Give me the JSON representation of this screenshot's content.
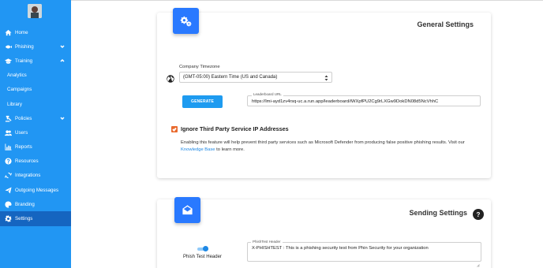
{
  "sidebar": {
    "items": [
      {
        "label": "Home",
        "icon": "home-icon"
      },
      {
        "label": "Phishing",
        "icon": "fish-icon",
        "chevron": "down"
      },
      {
        "label": "Training",
        "icon": "graduation-cap-icon",
        "chevron": "up"
      },
      {
        "label": "Analytics",
        "sub": true
      },
      {
        "label": "Campaigns",
        "sub": true
      },
      {
        "label": "Library",
        "sub": true
      },
      {
        "label": "Policies",
        "icon": "gavel-icon",
        "chevron": "down"
      },
      {
        "label": "Users",
        "icon": "users-icon"
      },
      {
        "label": "Reports",
        "icon": "bar-chart-icon"
      },
      {
        "label": "Resources",
        "icon": "question-circle-icon"
      },
      {
        "label": "Integrations",
        "icon": "refresh-icon"
      },
      {
        "label": "Outgoing Messages",
        "icon": "paper-plane-icon"
      },
      {
        "label": "Branding",
        "icon": "palette-icon"
      },
      {
        "label": "Settings",
        "icon": "gear-icon",
        "active": true
      }
    ]
  },
  "general": {
    "title": "General Settings",
    "timezone_label": "Company Timezone",
    "timezone_value": "(GMT-05:00) Eastern Time (US and Canada)",
    "generate_label": "GENERATE",
    "leaderboard_label": "Leaderboard URL",
    "leaderboard_url": "https://lmi-ayd1zv4rsq-uc.a.run.app/leaderboard/iWXpfPU2Cg9rLXGw9DokDN08d5NcVhhC",
    "ignore_label": "Ignore Third Party Service IP Addresses",
    "ignore_checked": true,
    "desc_text": "Enabling this feature will help prevent third party services such as Microsoft Defender from producing false positive phishing results. Visit our ",
    "desc_link": "Knowledge Base",
    "desc_end": " to learn more."
  },
  "sending": {
    "title": "Sending Settings",
    "help": "?",
    "toggle_label": "Phish Test Header",
    "toggle_on": true,
    "header_label": "PhishTest Header",
    "header_value": "X-PHISHTEST : This is a phishing security test from Phin Security for your organization"
  },
  "colors": {
    "sidebar": "#2196f3",
    "sidebar_active": "#1565c0",
    "accent": "#2979ff",
    "checkbox": "#e96a2e"
  }
}
